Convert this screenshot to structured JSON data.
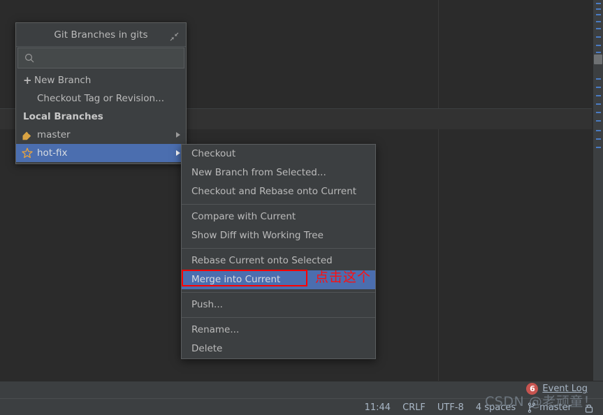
{
  "popup": {
    "title": "Git Branches in gits",
    "collapse_icon": "collapse-icon",
    "search_placeholder": "",
    "search_value": "",
    "actions": [
      {
        "label": "New Branch",
        "icon": "plus-icon"
      },
      {
        "label": "Checkout Tag or Revision...",
        "icon": ""
      }
    ],
    "group_label": "Local Branches",
    "branches": [
      {
        "label": "master",
        "icon": "tag-icon",
        "selected": false,
        "has_submenu": true
      },
      {
        "label": "hot-fix",
        "icon": "star-icon",
        "selected": true,
        "has_submenu": true
      }
    ]
  },
  "context_menu": {
    "groups": [
      {
        "items": [
          {
            "label": "Checkout",
            "highlighted": false
          },
          {
            "label": "New Branch from Selected...",
            "highlighted": false
          },
          {
            "label": "Checkout and Rebase onto Current",
            "highlighted": false
          }
        ]
      },
      {
        "items": [
          {
            "label": "Compare with Current",
            "highlighted": false
          },
          {
            "label": "Show Diff with Working Tree",
            "highlighted": false
          }
        ]
      },
      {
        "items": [
          {
            "label": "Rebase Current onto Selected",
            "highlighted": false
          },
          {
            "label": "Merge into Current",
            "highlighted": true
          }
        ]
      },
      {
        "items": [
          {
            "label": "Push...",
            "highlighted": false
          }
        ]
      },
      {
        "items": [
          {
            "label": "Rename...",
            "highlighted": false
          },
          {
            "label": "Delete",
            "highlighted": false
          }
        ]
      }
    ]
  },
  "annotation": {
    "text": "点击这个",
    "color": "#fd0f0f",
    "target": "Merge into Current"
  },
  "status_bar": {
    "event_log_label": "Event Log",
    "event_log_count": "6",
    "time": "11:44",
    "line_separator": "CRLF",
    "encoding": "UTF-8",
    "indent": "4 spaces",
    "branch": "master",
    "lock_icon": "lock-icon"
  },
  "watermark": {
    "text": "CSDN @老顽童！"
  },
  "colors": {
    "selection_blue": "#4b6eaf",
    "annotation_red": "#fd0f0f",
    "badge_red": "#c75450",
    "panel_bg": "#3c3f41",
    "editor_bg": "#2b2b2b",
    "text": "#bbbbbb",
    "status_text": "#a9b7c6",
    "branch_icon_gold": "#d9a343"
  }
}
